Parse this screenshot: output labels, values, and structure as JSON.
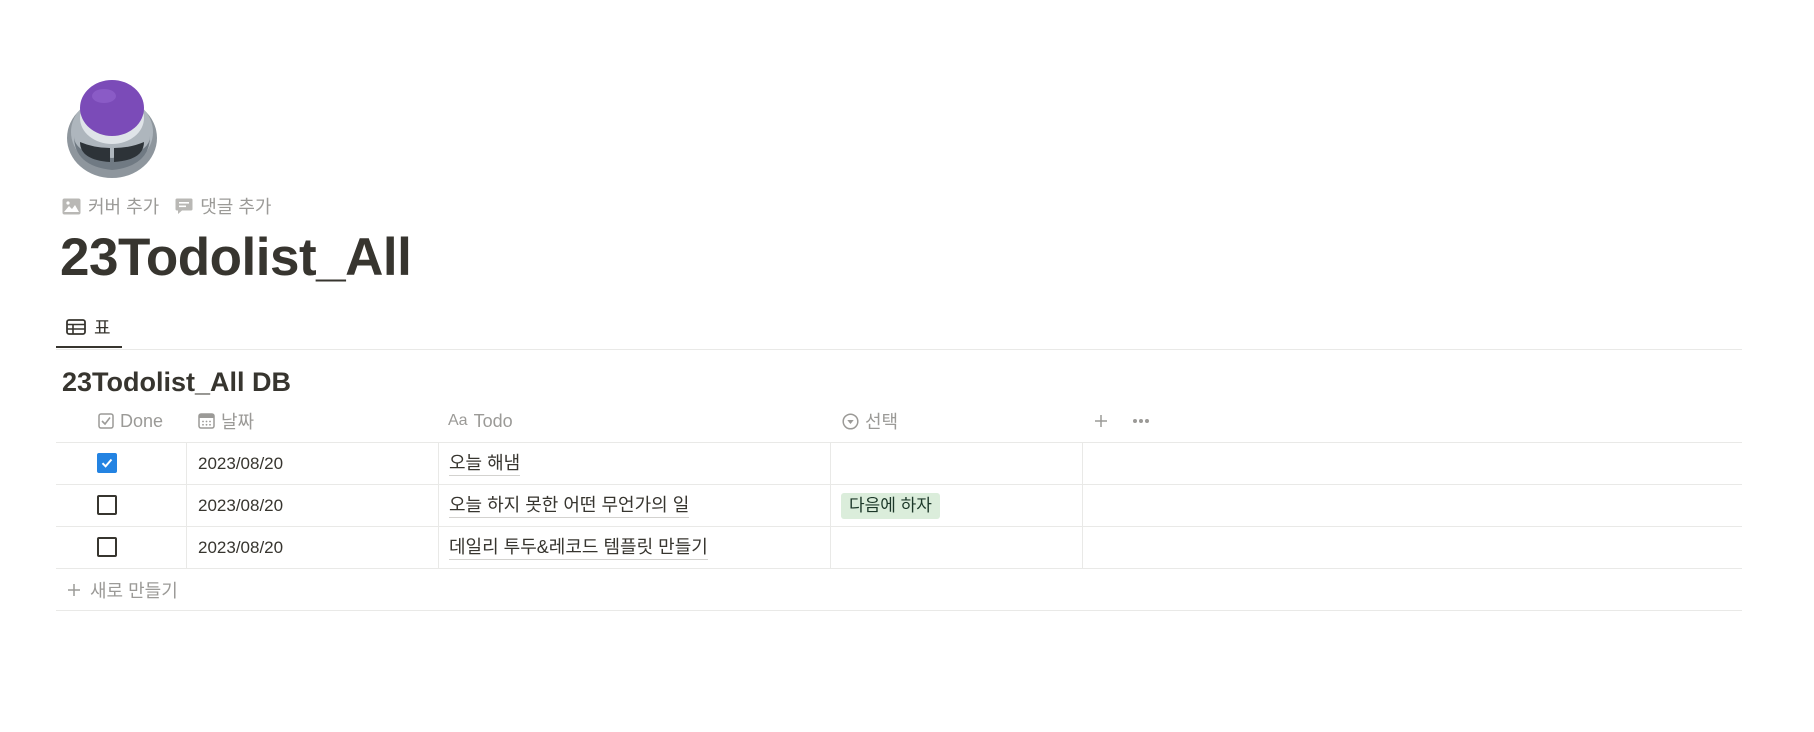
{
  "page": {
    "icon": "joystick-icon",
    "actions": [
      {
        "label": "커버 추가",
        "icon": "image-icon"
      },
      {
        "label": "댓글 추가",
        "icon": "comment-icon"
      }
    ],
    "title": "23Todolist_All"
  },
  "views": [
    {
      "label": "표",
      "icon": "table-icon",
      "active": true
    }
  ],
  "database": {
    "title": "23Todolist_All DB",
    "columns": [
      {
        "label": "Done",
        "icon": "checkbox-icon"
      },
      {
        "label": "날짜",
        "icon": "calendar-icon"
      },
      {
        "label": "Todo",
        "icon": "text-aa-icon",
        "icon_text": "Aa"
      },
      {
        "label": "선택",
        "icon": "select-icon"
      }
    ],
    "rows": [
      {
        "done": true,
        "date": "2023/08/20",
        "todo": "오늘 해냄",
        "select": ""
      },
      {
        "done": false,
        "date": "2023/08/20",
        "todo": "오늘 하지 못한 어떤 무언가의 일",
        "select": "다음에 하자"
      },
      {
        "done": false,
        "date": "2023/08/20",
        "todo": "데일리 투두&레코드 템플릿 만들기",
        "select": ""
      }
    ],
    "new_row_label": "새로 만들기"
  },
  "colors": {
    "text": "#37352f",
    "muted": "#9b9a97",
    "checkbox_checked": "#2383e2",
    "tag_green_bg": "#dbeddb",
    "joystick_button": "#7b4bb8"
  }
}
